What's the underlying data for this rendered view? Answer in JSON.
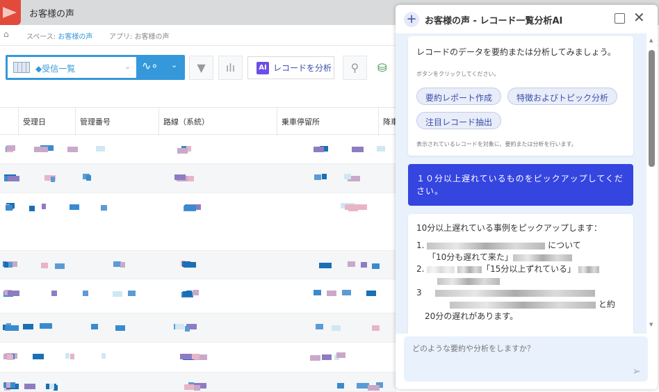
{
  "app": {
    "title": "お客様の声"
  },
  "breadcrumb": {
    "space_prefix": "スペース: ",
    "space": "お客様の声",
    "app_prefix": "アプリ: ",
    "app": "お客様の声"
  },
  "toolbar": {
    "view": "◆受信一覧",
    "analyze_label": "レコードを分析",
    "ai_badge": "AI"
  },
  "table": {
    "headers": [
      "受理日",
      "管理番号",
      "路線（系統）",
      "乗車停留所",
      "降車"
    ]
  },
  "panel": {
    "title": "お客様の声 - レコード一覧分析AI",
    "intro": "レコードのデータを要約または分析してみましょう。",
    "hint": "ボタンをクリックしてください。",
    "buttons": [
      "要約レポート作成",
      "特徴およびトピック分析",
      "注目レコード抽出"
    ],
    "note": "表示されているレコードを対象に、要約または分析を行います。",
    "user_message": "１０分以上遅れているものをピックアップしてください。",
    "response": {
      "lead": "10分以上遅れている事例をピックアップします：",
      "item1_end": "について",
      "item1_quote": "「10分も遅れて来た」",
      "item2_quote": "「15分以上ずれている」",
      "item3_end": "と約",
      "item3_tail": "20分の遅れがあります。"
    },
    "input_placeholder": "どのような要約や分析をしますか？"
  },
  "colors": {
    "accent": "#3498db",
    "user_bubble": "#3545e0",
    "chip_text": "#3a4ea8"
  }
}
